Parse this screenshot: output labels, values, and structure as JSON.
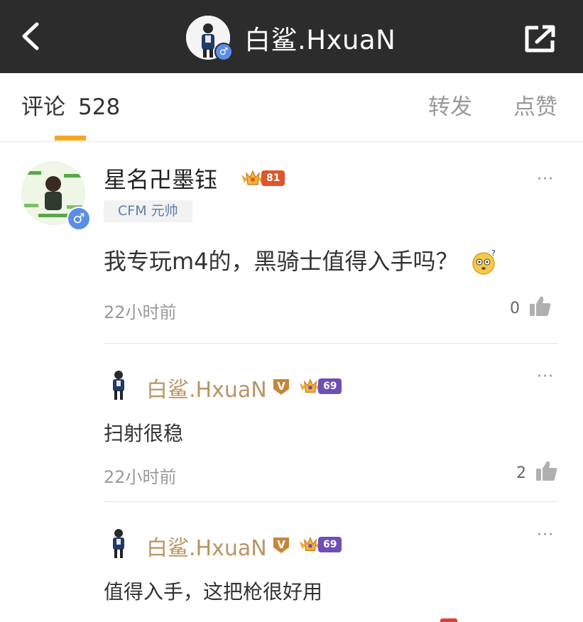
{
  "header": {
    "title": "白鲨.HxuaN",
    "gender_symbol": "♂"
  },
  "tabs": {
    "comments_label": "评论",
    "comments_count": "528",
    "repost_label": "转发",
    "likes_label": "点赞"
  },
  "comment": {
    "author": "星名卍墨钰",
    "rank_level": "81",
    "tag": "CFM 元帅",
    "text": "我专玩m4的，黑骑士值得入手吗？",
    "emoji": "confused-face",
    "time": "22小时前",
    "like_count": "0",
    "more": "···",
    "gender_symbol": "♂"
  },
  "replies": [
    {
      "author": "白鲨.HxuaN",
      "v_badge": "V",
      "rank_level": "69",
      "text": "扫射很稳",
      "time": "22小时前",
      "like_count": "2",
      "more": "···"
    },
    {
      "author": "白鲨.HxuaN",
      "v_badge": "V",
      "rank_level": "69",
      "text": "值得入手，这把枪很好用",
      "more": "···"
    }
  ],
  "colors": {
    "topbar": "#2c2c2c",
    "accent": "#f5a623",
    "reply_name": "#b99463",
    "rank_orange": "#e0562a",
    "rank_purple": "#6e4fb5",
    "v_badge": "#c5873a"
  }
}
